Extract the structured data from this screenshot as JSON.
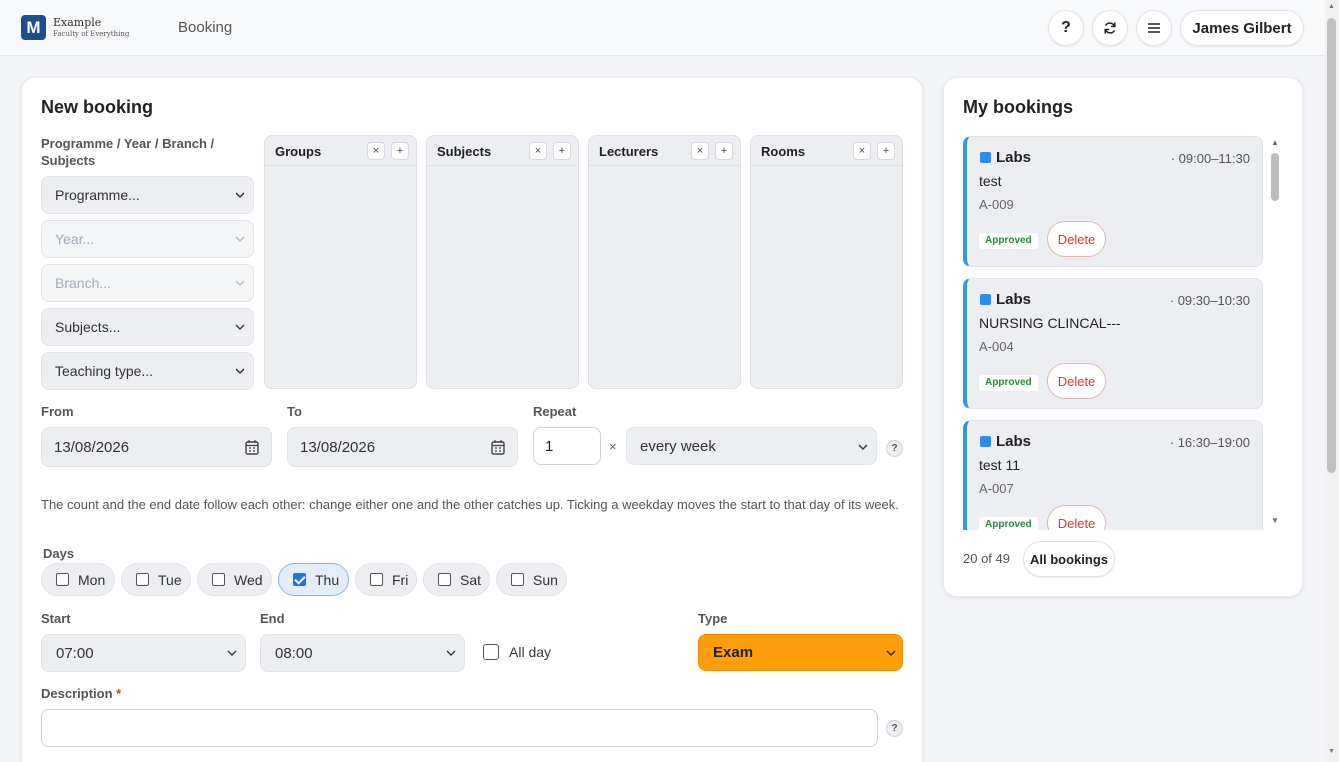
{
  "header": {
    "logo_letter": "M",
    "org_name": "Example",
    "org_sub": "Faculty of Everything",
    "page_title": "Booking",
    "help_label": "?",
    "user_name": "James Gilbert"
  },
  "new_booking": {
    "title": "New booking",
    "filter_label": "Programme / Year / Branch / Subjects",
    "selects": {
      "programme": "Programme...",
      "year": "Year...",
      "branch": "Branch...",
      "subjects": "Subjects...",
      "teaching_type": "Teaching type..."
    },
    "listboxes": {
      "groups": "Groups",
      "subjects": "Subjects",
      "lecturers": "Lecturers",
      "rooms": "Rooms",
      "clear_symbol": "×",
      "add_symbol": "+"
    },
    "from_label": "From",
    "from_value": "13/08/2026",
    "to_label": "To",
    "to_value": "13/08/2026",
    "repeat_label": "Repeat",
    "repeat_count": "1",
    "times_symbol": "×",
    "repeat_interval": "every week",
    "help_symbol": "?",
    "hint": "The count and the end date follow each other: change either one and the other catches up. Ticking a weekday moves the start to that day of its week.",
    "days_label": "Days",
    "days": [
      {
        "label": "Mon",
        "checked": false
      },
      {
        "label": "Tue",
        "checked": false
      },
      {
        "label": "Wed",
        "checked": false
      },
      {
        "label": "Thu",
        "checked": true
      },
      {
        "label": "Fri",
        "checked": false
      },
      {
        "label": "Sat",
        "checked": false
      },
      {
        "label": "Sun",
        "checked": false
      }
    ],
    "start_label": "Start",
    "start_value": "07:00",
    "end_label": "End",
    "end_value": "08:00",
    "all_day_label": "All day",
    "type_label": "Type",
    "type_value": "Exam",
    "type_color": "#ff9d0a",
    "description_label": "Description",
    "required_mark": "*",
    "description_value": ""
  },
  "my_bookings": {
    "title": "My bookings",
    "items": [
      {
        "category": "Labs",
        "time": "· 09:00–11:30",
        "title": "test",
        "room": "A-009",
        "status": "Approved",
        "delete_label": "Delete"
      },
      {
        "category": "Labs",
        "time": "· 09:30–10:30",
        "title": "NURSING CLINCAL---",
        "room": "A-004",
        "status": "Approved",
        "delete_label": "Delete"
      },
      {
        "category": "Labs",
        "time": "· 16:30–19:00",
        "title": "test 11",
        "room": "A-007",
        "status": "Approved",
        "delete_label": "Delete"
      }
    ],
    "count_text": "20 of 49",
    "all_label": "All bookings",
    "accent_color": "#2d9cdb"
  }
}
